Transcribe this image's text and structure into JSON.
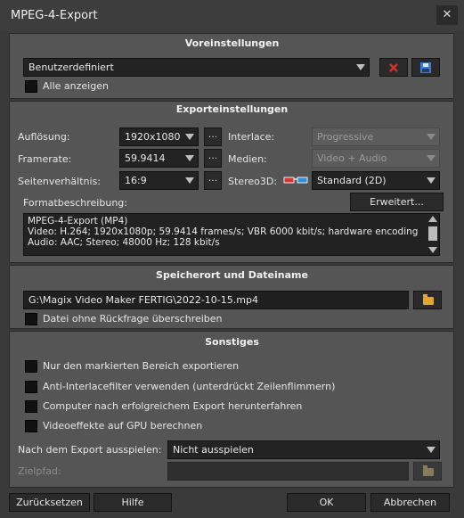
{
  "window": {
    "title": "MPEG-4-Export",
    "close_glyph": "✕"
  },
  "presets": {
    "heading": "Voreinstellungen",
    "selected": "Benutzerdefiniert",
    "show_all_label": "Alle anzeigen",
    "show_all_checked": false
  },
  "export": {
    "heading": "Exporteinstellungen",
    "resolution_label": "Auflösung:",
    "resolution_value": "1920x1080",
    "framerate_label": "Framerate:",
    "framerate_value": "59.9414",
    "aspect_label": "Seitenverhältnis:",
    "aspect_value": "16:9",
    "interlace_label": "Interlace:",
    "interlace_value": "Progressive",
    "media_label": "Medien:",
    "media_value": "Video + Audio",
    "stereo_label": "Stereo3D:",
    "stereo_value": "Standard (2D)",
    "more_glyph": "...",
    "format_label": "Formatbeschreibung:",
    "advanced_button": "Erweitert...",
    "description_lines": [
      "MPEG-4-Export (MP4)",
      "Video: H.264; 1920x1080p; 59.9414 frames/s; VBR 6000 kbit/s; hardware encoding",
      "Audio: AAC; Stereo; 48000 Hz; 128 kbit/s"
    ]
  },
  "location": {
    "heading": "Speicherort und Dateiname",
    "path": "G:\\Magix Video Maker FERTIG\\2022-10-15.mp4",
    "overwrite_label": "Datei ohne Rückfrage überschreiben"
  },
  "misc": {
    "heading": "Sonstiges",
    "options": [
      "Nur den markierten Bereich exportieren",
      "Anti-Interlacefilter verwenden (unterdrückt Zeilenflimmern)",
      "Computer nach erfolgreichem Export herunterfahren",
      "Videoeffekte auf GPU berechnen"
    ],
    "after_export_label": "Nach dem Export ausspielen:",
    "after_export_value": "Nicht ausspielen",
    "target_label": "Zielpfad:",
    "target_value": ""
  },
  "footer": {
    "reset": "Zurücksetzen",
    "help": "Hilfe",
    "ok": "OK",
    "cancel": "Abbrechen"
  },
  "colors": {
    "accent_folder": "#e2a62d",
    "delete_red": "#d0302a",
    "save_blue": "#3a7bd5"
  }
}
